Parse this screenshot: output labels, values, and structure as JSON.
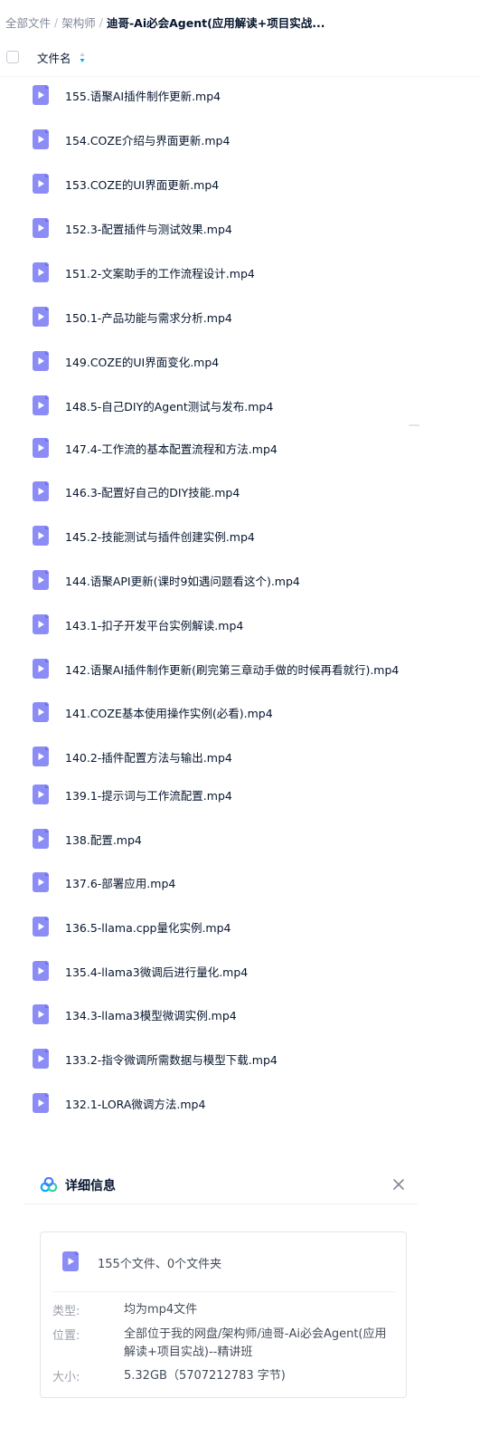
{
  "breadcrumb": {
    "root": "全部文件",
    "middle": "架构师",
    "current": "迪哥-Ai必会Agent(应用解读+项目实战..."
  },
  "list_header": {
    "column_title": "文件名"
  },
  "files": [
    {
      "name": "155.语聚AI插件制作更新.mp4"
    },
    {
      "name": "154.COZE介绍与界面更新.mp4"
    },
    {
      "name": "153.COZE的UI界面更新.mp4"
    },
    {
      "name": "152.3-配置插件与测试效果.mp4"
    },
    {
      "name": "151.2-文案助手的工作流程设计.mp4"
    },
    {
      "name": "150.1-产品功能与需求分析.mp4"
    },
    {
      "name": "149.COZE的UI界面变化.mp4"
    },
    {
      "name": "148.5-自己DIY的Agent测试与发布.mp4"
    },
    {
      "name": "147.4-工作流的基本配置流程和方法.mp4"
    },
    {
      "name": "146.3-配置好自己的DIY技能.mp4"
    },
    {
      "name": "145.2-技能测试与插件创建实例.mp4"
    },
    {
      "name": "144.语聚API更新(课时9如遇问题看这个).mp4"
    },
    {
      "name": "143.1-扣子开发平台实例解读.mp4"
    },
    {
      "name": "142.语聚AI插件制作更新(刷完第三章动手做的时候再看就行).mp4"
    },
    {
      "name": "141.COZE基本使用操作实例(必看).mp4"
    },
    {
      "name": "140.2-插件配置方法与输出.mp4"
    },
    {
      "name": "139.1-提示词与工作流配置.mp4"
    },
    {
      "name": "138.配置.mp4"
    },
    {
      "name": "137.6-部署应用.mp4"
    },
    {
      "name": "136.5-llama.cpp量化实例.mp4"
    },
    {
      "name": "135.4-llama3微调后进行量化.mp4"
    },
    {
      "name": "134.3-llama3模型微调实例.mp4"
    },
    {
      "name": "133.2-指令微调所需数据与模型下载.mp4"
    },
    {
      "name": "132.1-LORA微调方法.mp4"
    }
  ],
  "details": {
    "title": "详细信息",
    "summary": "155个文件、0个文件夹",
    "type_label": "类型:",
    "type_value": "均为mp4文件",
    "location_label": "位置:",
    "location_value": "全部位于我的网盘/架构师/迪哥-Ai必会Agent(应用解读+项目实战)--精讲班",
    "size_label": "大小:",
    "size_value": "5.32GB（5707212783 字节)"
  },
  "colors": {
    "file_icon": "#8c8cf7",
    "file_icon_dark": "#6f6fe8",
    "accent": "#06a7ff",
    "text_primary": "#06162e",
    "text_secondary": "#818999"
  }
}
